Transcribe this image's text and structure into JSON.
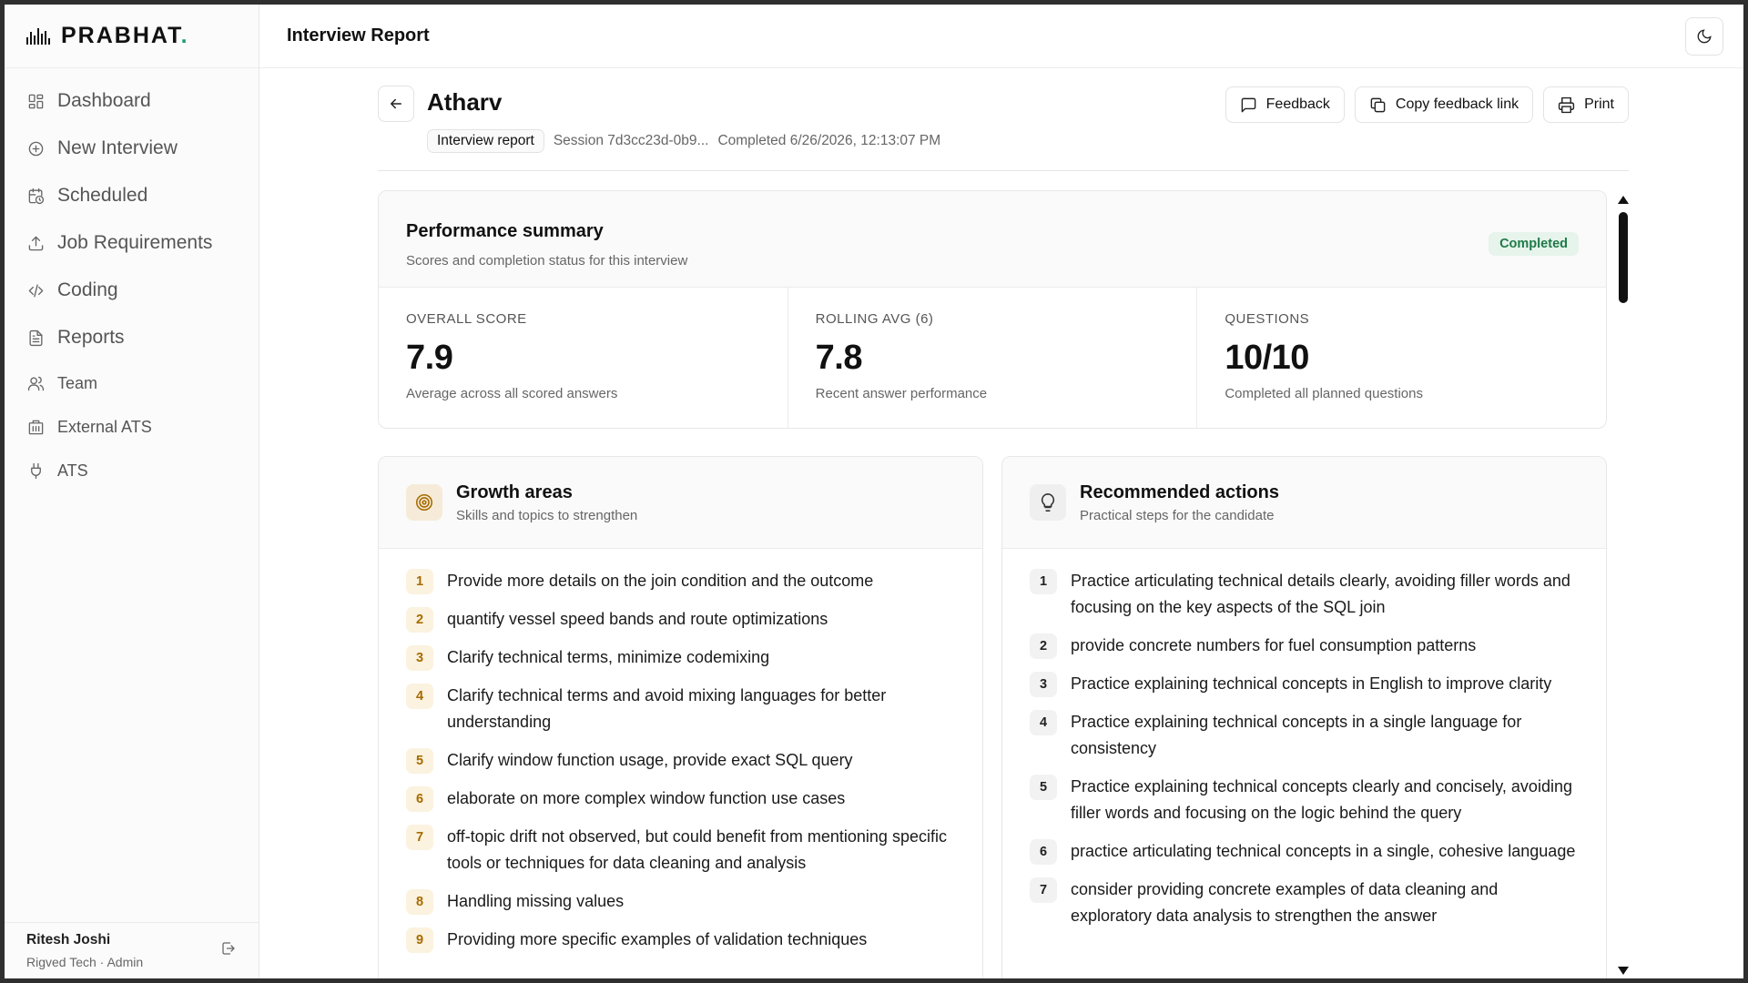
{
  "brand": {
    "name": "PRABHAT",
    "dot": "."
  },
  "sidebar": {
    "items": [
      {
        "label": "Dashboard",
        "icon": "dashboard-icon"
      },
      {
        "label": "New Interview",
        "icon": "plus-circle-icon"
      },
      {
        "label": "Scheduled",
        "icon": "calendar-clock-icon"
      },
      {
        "label": "Job Requirements",
        "icon": "upload-icon"
      },
      {
        "label": "Coding",
        "icon": "code-icon"
      },
      {
        "label": "Reports",
        "icon": "file-text-icon"
      },
      {
        "label": "Team",
        "icon": "users-icon"
      },
      {
        "label": "External ATS",
        "icon": "building-icon"
      },
      {
        "label": "ATS",
        "icon": "plug-icon"
      }
    ]
  },
  "user": {
    "name": "Ritesh Joshi",
    "meta": "Rigved Tech · Admin"
  },
  "topbar": {
    "title": "Interview Report"
  },
  "header": {
    "candidate": "Atharv",
    "pill": "Interview report",
    "session": "Session 7d3cc23d-0b9...",
    "completed": "Completed 6/26/2026, 12:13:07 PM",
    "actions": {
      "feedback": "Feedback",
      "copy": "Copy feedback link",
      "print": "Print"
    }
  },
  "summary": {
    "title": "Performance summary",
    "subtitle": "Scores and completion status for this interview",
    "status": "Completed",
    "status_color": "#1f7a47",
    "stats": [
      {
        "label": "OVERALL SCORE",
        "value": "7.9",
        "desc": "Average across all scored answers"
      },
      {
        "label": "ROLLING AVG (6)",
        "value": "7.8",
        "desc": "Recent answer performance"
      },
      {
        "label": "QUESTIONS",
        "value": "10/10",
        "desc": "Completed all planned questions"
      }
    ]
  },
  "growth": {
    "title": "Growth areas",
    "subtitle": "Skills and topics to strengthen",
    "items": [
      {
        "n": "1",
        "text": "Provide more details on the join condition and the outcome"
      },
      {
        "n": "2",
        "text": "quantify vessel speed bands and route optimizations"
      },
      {
        "n": "3",
        "text": "Clarify technical terms, minimize codemixing"
      },
      {
        "n": "4",
        "text": "Clarify technical terms and avoid mixing languages for better understanding"
      },
      {
        "n": "5",
        "text": "Clarify window function usage, provide exact SQL query"
      },
      {
        "n": "6",
        "text": "elaborate on more complex window function use cases"
      },
      {
        "n": "7",
        "text": "off-topic drift not observed, but could benefit from mentioning specific tools or techniques for data cleaning and analysis"
      },
      {
        "n": "8",
        "text": "Handling missing values"
      },
      {
        "n": "9",
        "text": "Providing more specific examples of validation techniques"
      }
    ]
  },
  "actions_card": {
    "title": "Recommended actions",
    "subtitle": "Practical steps for the candidate",
    "items": [
      {
        "n": "1",
        "text": "Practice articulating technical details clearly, avoiding filler words and focusing on the key aspects of the SQL join"
      },
      {
        "n": "2",
        "text": "provide concrete numbers for fuel consumption patterns"
      },
      {
        "n": "3",
        "text": "Practice explaining technical concepts in English to improve clarity"
      },
      {
        "n": "4",
        "text": "Practice explaining technical concepts in a single language for consistency"
      },
      {
        "n": "5",
        "text": "Practice explaining technical concepts clearly and concisely, avoiding filler words and focusing on the logic behind the query"
      },
      {
        "n": "6",
        "text": "practice articulating technical concepts in a single, cohesive language"
      },
      {
        "n": "7",
        "text": "consider providing concrete examples of data cleaning and exploratory data analysis to strengthen the answer"
      }
    ]
  },
  "colors": {
    "brand_dot": "#1aa06d",
    "growth_accent": "#a66b00",
    "completed_bg": "#e6f4ec"
  }
}
